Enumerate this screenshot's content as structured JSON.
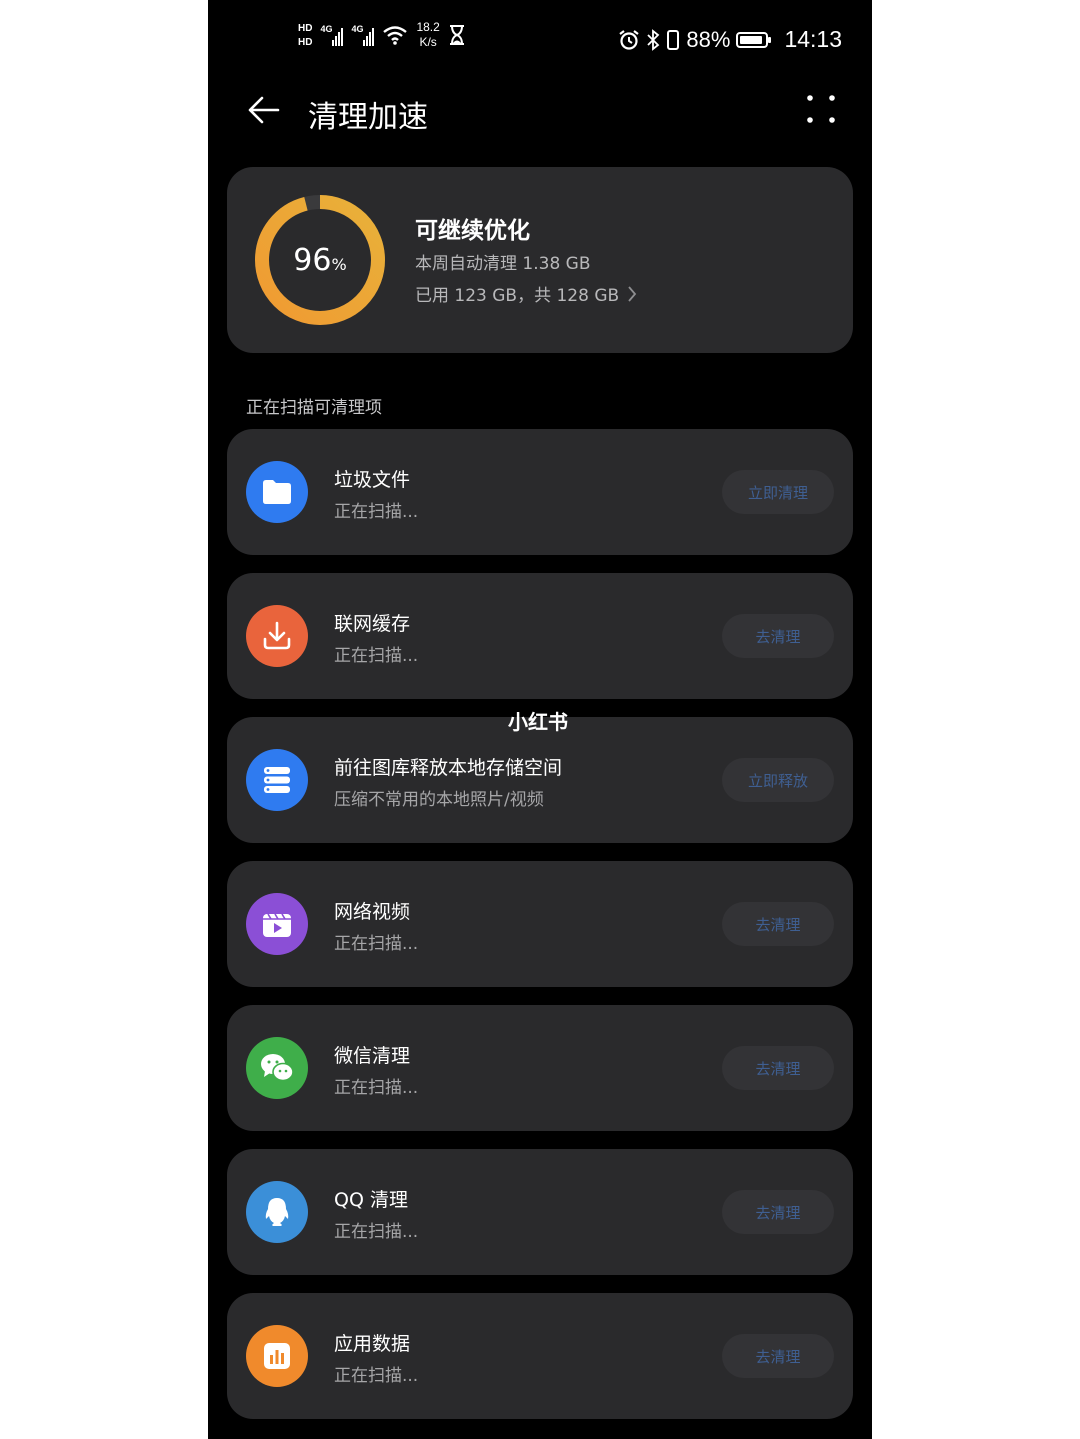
{
  "status_bar": {
    "sim1": "HD",
    "sim2": "HD",
    "net_gen_1": "4G",
    "net_gen_2": "4G",
    "speed_value": "18.2",
    "speed_unit": "K/s",
    "battery_pct": "88%",
    "battery_level": 0.88,
    "time": "14:13"
  },
  "header": {
    "title": "清理加速"
  },
  "summary": {
    "percent_value": 96,
    "percent_number": "96",
    "percent_unit": "%",
    "status": "可继续优化",
    "weekly": "本周自动清理 1.38 GB",
    "storage": "已用 123 GB，共 128 GB",
    "ring_color": "#f0a02c"
  },
  "section_title": "正在扫描可清理项",
  "items": [
    {
      "title": "垃圾文件",
      "subtitle": "正在扫描...",
      "button": "立即清理",
      "icon": "folder-icon",
      "color": "#2f7bf0"
    },
    {
      "title": "联网缓存",
      "subtitle": "正在扫描...",
      "button": "去清理",
      "icon": "download-icon",
      "color": "#e9643c"
    },
    {
      "title": "前往图库释放本地存储空间",
      "subtitle": "压缩不常用的本地照片/视频",
      "button": "立即释放",
      "icon": "storage-icon",
      "color": "#2f7bf0"
    },
    {
      "title": "网络视频",
      "subtitle": "正在扫描...",
      "button": "去清理",
      "icon": "video-icon",
      "color": "#8b4fd6"
    },
    {
      "title": "微信清理",
      "subtitle": "正在扫描...",
      "button": "去清理",
      "icon": "wechat-icon",
      "color": "#3fae4a"
    },
    {
      "title": "QQ 清理",
      "subtitle": "正在扫描...",
      "button": "去清理",
      "icon": "qq-icon",
      "color": "#3b8fd8"
    },
    {
      "title": "应用数据",
      "subtitle": "正在扫描...",
      "button": "去清理",
      "icon": "app-data-icon",
      "color": "#f08a2c"
    }
  ],
  "watermark": "小红书"
}
